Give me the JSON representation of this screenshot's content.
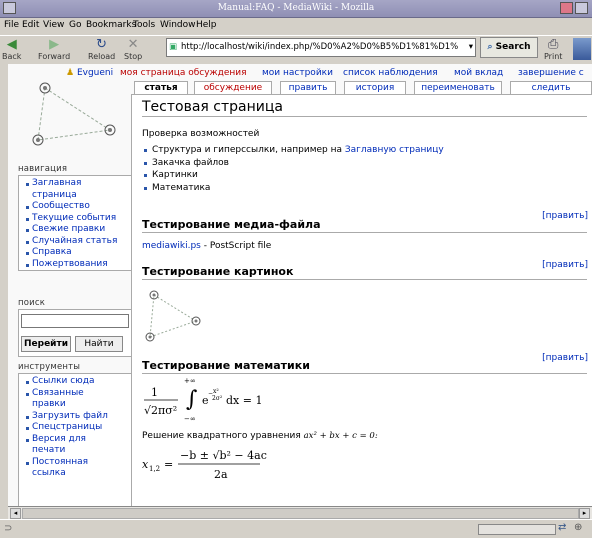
{
  "window": {
    "title": "Manual:FAQ - MediaWiki - Mozilla"
  },
  "menu": {
    "file": "File",
    "edit": "Edit",
    "view": "View",
    "go": "Go",
    "bookmarks": "Bookmarks",
    "tools": "Tools",
    "window": "Window",
    "help": "Help"
  },
  "toolbar": {
    "back": "Back",
    "forward": "Forward",
    "reload": "Reload",
    "stop": "Stop",
    "print": "Print",
    "search": "Search"
  },
  "url": "http://localhost/wiki/index.php/%D0%A2%D0%B5%D1%81%D1%",
  "topnav": {
    "user": "Evgueni",
    "talk": "моя страница обсуждения",
    "prefs": "мои настройки",
    "watchlist": "список наблюдения",
    "contribs": "мой вклад",
    "logout": "завершение с"
  },
  "tabs": {
    "article": "статья",
    "discussion": "обсуждение",
    "edit": "править",
    "history": "история",
    "move": "переименовать",
    "watch": "следить"
  },
  "sidebar": {
    "nav_heading": "навигация",
    "nav_items": [
      "Заглавная страница",
      "Сообщество",
      "Текущие события",
      "Свежие правки",
      "Случайная статья",
      "Справка",
      "Пожертвования"
    ],
    "search_heading": "поиск",
    "go_button": "Перейти",
    "search_button": "Найти",
    "tools_heading": "инструменты",
    "tools_items": [
      "Ссылки сюда",
      "Связанные правки",
      "Загрузить файл",
      "Спецстраницы",
      "Версия для печати",
      "Постоянная ссылка"
    ]
  },
  "content": {
    "title": "Тестовая страница",
    "intro": "Проверка возможностей",
    "bullets": [
      "Структура и гиперссылки, например на ",
      "Закачка файлов",
      "Картинки",
      "Математика"
    ],
    "bullet_link": "Заглавную страницу",
    "edit_label": "[править]",
    "section_media": "Тестирование медиа-файла",
    "media_link": "mediawiki.ps",
    "media_text": " - PostScript file",
    "section_images": "Тестирование картинок",
    "section_math": "Тестирование математики",
    "quadratic_text": "Решение квадратного уравнения "
  },
  "colors": {
    "link": "#002bb8",
    "titlebar": "#8f8fb4"
  }
}
